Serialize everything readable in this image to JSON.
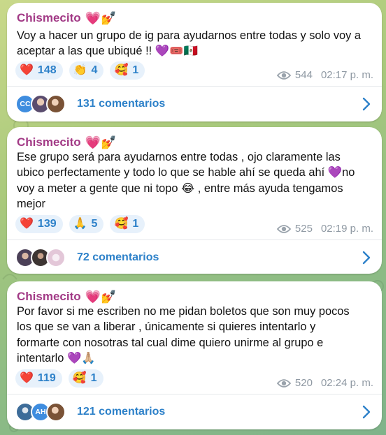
{
  "colors": {
    "author": "#a23a86",
    "link": "#2d81c9",
    "pill_bg": "#e7f1fb",
    "meta": "#8f99a3"
  },
  "posts": [
    {
      "author": "Chismecito",
      "author_emojis": "💗💅",
      "text_lines": [
        "Voy a hacer un grupo de ig para ayudarnos entre todas y solo voy a",
        "aceptar a las que ubiqué !! 💜🎟️🇲🇽"
      ],
      "reactions": [
        {
          "emoji": "❤️",
          "count": "148",
          "icon": "heart-icon"
        },
        {
          "emoji": "👏",
          "count": "4",
          "icon": "clap-icon"
        },
        {
          "emoji": "🥰",
          "count": "1",
          "icon": "smiling-hearts-icon"
        }
      ],
      "views": "544",
      "time": "02:17 p. m.",
      "comments_label": "131 comentarios",
      "commenter_avatars": [
        {
          "type": "initials",
          "text": "CC",
          "color": "#3f8ddf"
        },
        {
          "type": "photo",
          "color": "#5a4c6e"
        },
        {
          "type": "photo",
          "color": "#b07e5e"
        }
      ]
    },
    {
      "author": "Chismecito",
      "author_emojis": "💗💅",
      "text_lines": [
        "Ese grupo será para ayudarnos entre todas , ojo claramente las",
        "ubico perfectamente y todo lo que se hable ahí se queda ahí 💜no",
        "voy a meter a gente que ni topo 😂 , entre más ayuda tengamos",
        "mejor"
      ],
      "reactions": [
        {
          "emoji": "❤️",
          "count": "139",
          "icon": "heart-icon"
        },
        {
          "emoji": "🙏",
          "count": "5",
          "icon": "pray-icon"
        },
        {
          "emoji": "🥰",
          "count": "1",
          "icon": "smiling-hearts-icon"
        }
      ],
      "views": "525",
      "time": "02:19 p. m.",
      "comments_label": "72 comentarios",
      "commenter_avatars": [
        {
          "type": "photo",
          "color": "#4b4057"
        },
        {
          "type": "photo",
          "color": "#3d3533"
        },
        {
          "type": "photo",
          "color": "#e3c7d8"
        }
      ]
    },
    {
      "author": "Chismecito",
      "author_emojis": "💗💅",
      "text_lines": [
        "Por favor si me escriben no me pidan boletos que son muy pocos",
        "los que se van a liberar , únicamente si quieres intentarlo y",
        "formarte con nosotras tal cual dime quiero unirme al grupo e",
        "intentarlo 💜🙏🏼"
      ],
      "reactions": [
        {
          "emoji": "❤️",
          "count": "119",
          "icon": "heart-icon"
        },
        {
          "emoji": "🥰",
          "count": "1",
          "icon": "smiling-hearts-icon"
        }
      ],
      "views": "520",
      "time": "02:24 p. m.",
      "comments_label": "121 comentarios",
      "commenter_avatars": [
        {
          "type": "photo",
          "color": "#3d6c99"
        },
        {
          "type": "initials",
          "text": "AH",
          "color": "#3f8ddf"
        },
        {
          "type": "photo",
          "color": "#b07e5e"
        }
      ]
    }
  ]
}
